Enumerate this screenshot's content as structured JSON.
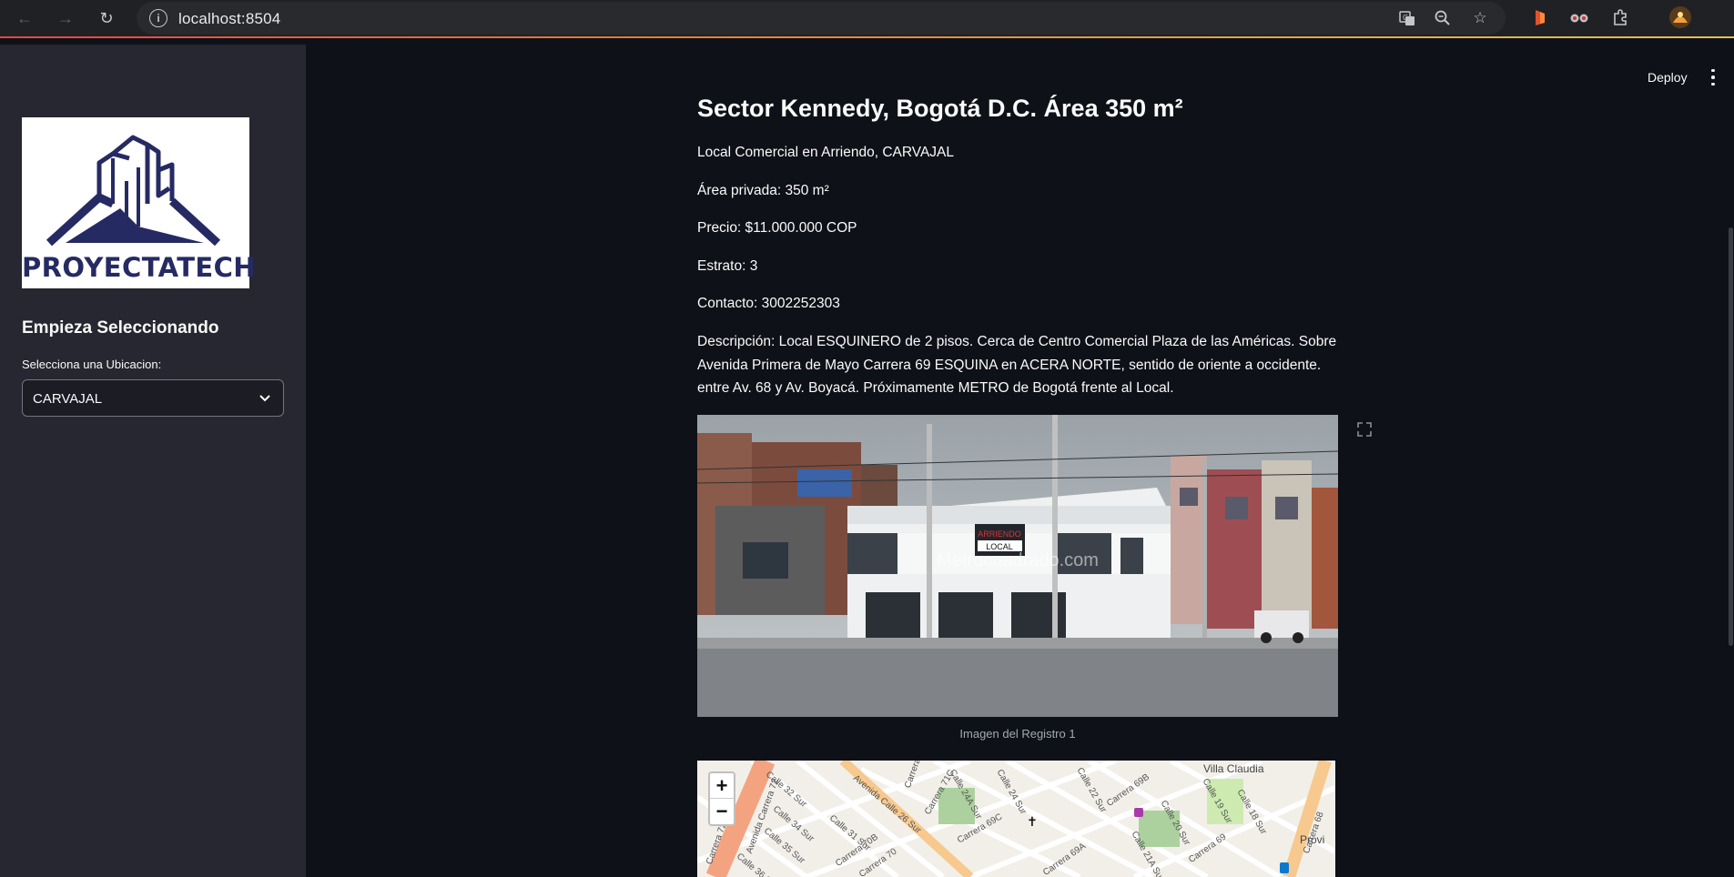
{
  "browser": {
    "url": "localhost:8504"
  },
  "sidebar": {
    "logo_text": "PROYECTATECH",
    "heading": "Empieza Seleccionando",
    "select_label": "Selecciona una Ubicacion:",
    "select_value": "CARVAJAL"
  },
  "header": {
    "deploy_label": "Deploy"
  },
  "listing": {
    "title": "Sector Kennedy, Bogotá D.C. Área 350 m²",
    "type_line": "Local Comercial en Arriendo, CARVAJAL",
    "area_line": "Área privada: 350 m²",
    "price_line": "Precio: $11.000.000 COP",
    "estrato_line": "Estrato: 3",
    "contact_line": "Contacto: 3002252303",
    "description": "Descripción: Local ESQUINERO de 2 pisos. Cerca de Centro Comercial Plaza de las Américas. Sobre Avenida Primera de Mayo Carrera 69 ESQUINA en ACERA NORTE, sentido de oriente a occidente. entre Av. 68 y Av. Boyacá. Próximamente METRO de Bogotá frente al Local.",
    "image_sign_1": "ARRIENDO",
    "image_sign_2": "LOCAL",
    "image_watermark": "Metrocuadrado.com",
    "image_caption": "Imagen del Registro 1"
  },
  "map": {
    "zoom_in": "+",
    "zoom_out": "−",
    "place": "Villa Claudia",
    "place_2": "Provi",
    "streets": [
      "Avenida Carrera 72",
      "Carrera 72J",
      "Calle 32 Sur",
      "Calle 34 Sur",
      "Calle 35 Sur",
      "Calle 36 Sur",
      "Carrera 70B",
      "Carrera 70",
      "Calle 31 Sur",
      "Carrera 71B",
      "Carrera 71C",
      "Carrera 69C",
      "Calle 24A Sur",
      "Avenida Calle 26 Sur",
      "Calle 24 Sur",
      "Calle 22 Sur",
      "Calle 20 Sur",
      "Calle 19 Sur",
      "Calle 18 Sur",
      "Carrera 69",
      "Carrera 69B",
      "Carrera 69A",
      "Calle 21A Sur",
      "Carrera 68"
    ]
  },
  "colors": {
    "app_bg": "#0e1117",
    "sidebar_bg": "#262730",
    "logo_navy": "#262a63",
    "accent_red": "#ff4b4b"
  }
}
